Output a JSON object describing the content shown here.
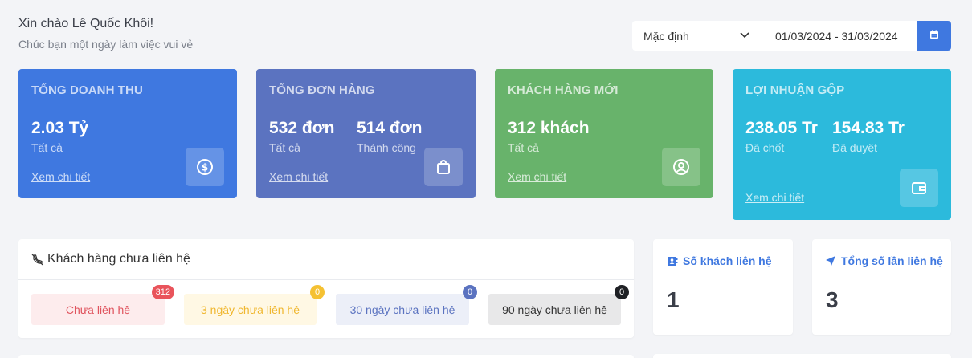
{
  "header": {
    "greeting": "Xin chào Lê Quốc Khôi!",
    "subtitle": "Chúc bạn một ngày làm việc vui vẻ"
  },
  "filters": {
    "period_select": "Mặc định",
    "date_range": "01/03/2024 - 31/03/2024"
  },
  "cards": {
    "revenue": {
      "title": "TỔNG DOANH THU",
      "value": "2.03 Tỷ",
      "label": "Tất cả",
      "link": "Xem chi tiết",
      "icon": "dollar-icon",
      "color": "#3f78e0"
    },
    "orders": {
      "title": "TỔNG ĐƠN HÀNG",
      "value1": "532 đơn",
      "label1": "Tất cả",
      "value2": "514 đơn",
      "label2": "Thành công",
      "link": "Xem chi tiết",
      "icon": "shopping-bag-icon",
      "color": "#5b73c0"
    },
    "customers": {
      "title": "KHÁCH HÀNG MỚI",
      "value": "312 khách",
      "label": "Tất cả",
      "link": "Xem chi tiết",
      "icon": "user-circle-icon",
      "color": "#68b36b"
    },
    "profit": {
      "title": "LỢI NHUẬN GỘP",
      "value1": "238.05 Tr",
      "label1": "Đã chốt",
      "value2": "154.83 Tr",
      "label2": "Đã duyệt",
      "link": "Xem chi tiết",
      "icon": "wallet-icon",
      "color": "#2cbadc"
    }
  },
  "uncontacted": {
    "title": "Khách hàng chưa liên hệ",
    "icon": "phone-off-icon",
    "pills": [
      {
        "label": "Chưa liên hệ",
        "count": "312"
      },
      {
        "label": "3 ngày chưa liên hệ",
        "count": "0"
      },
      {
        "label": "30 ngày chưa liên hệ",
        "count": "0"
      },
      {
        "label": "90 ngày chưa liên hệ",
        "count": "0"
      }
    ]
  },
  "stats": {
    "contacted_customers": {
      "title": "Số khách liên hệ",
      "value": "1",
      "icon": "contact-book-icon"
    },
    "total_contacts": {
      "title": "Tổng số lần liên hệ",
      "value": "3",
      "icon": "send-icon"
    }
  }
}
